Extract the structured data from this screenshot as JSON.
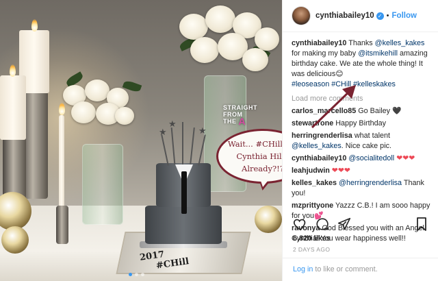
{
  "post": {
    "username": "cynthiabailey10",
    "follow_label": "Follow",
    "separator": "•",
    "caption": {
      "username": "cynthiabailey10",
      "text_1": "Thanks",
      "mention_1": "@kelles_kakes",
      "text_2": "for making my baby",
      "mention_2": "@itsmikehill",
      "text_3": "amazing birthday cake. We ate the whole thing! It was delicious",
      "emoji": "😊",
      "hashtag_1": "#leoseason",
      "hashtag_2": "#CHill",
      "hashtag_3": "#kelleskakes"
    },
    "load_more": "Load more comments",
    "comments": [
      {
        "user": "carlos_marcello85",
        "text": "Go Bailey",
        "emoji": "🖤",
        "emoji_kind": "black-heart"
      },
      {
        "user": "stewartrone",
        "text": "Happy Birthday",
        "emoji": "",
        "emoji_kind": ""
      },
      {
        "user": "herringrenderlisa",
        "text": "what talent",
        "mention": "@kelles_kakes",
        "text_after": ". Nice cake pic.",
        "emoji": "",
        "emoji_kind": ""
      },
      {
        "user": "cynthiabailey10",
        "mention": "@socialitedoll",
        "emoji": "❤❤❤",
        "emoji_kind": "red-hearts"
      },
      {
        "user": "leahjudwin",
        "emoji": "❤❤❤",
        "emoji_kind": "red-hearts"
      },
      {
        "user": "kelles_kakes",
        "mention": "@herringrenderlisa",
        "text_after": "Thank you!"
      },
      {
        "user": "mzprittyone",
        "text": "Yazzz C.B.! I am sooo happy for you",
        "emoji": "💕",
        "emoji_kind": "pink-hearts"
      },
      {
        "user": "ravonya",
        "text": "God Blessed you with an Angel Cynthia! You wear happiness well!!"
      }
    ],
    "likes": "6,820 likes",
    "time_ago": "2 DAYS AGO",
    "login_link": "Log in",
    "login_text": " to like or comment."
  },
  "photo": {
    "bubble_line_1": "Wait... #CHill ???",
    "bubble_line_2": "Cynthia Hill.. Already?!?",
    "cake_text_1": "2017",
    "cake_text_2": "#CHill",
    "watermark_line_1": "STRAIGHT",
    "watermark_line_2": "FROM",
    "watermark_line_3": "THE",
    "watermark_icon": "A"
  },
  "colors": {
    "accent_blue": "#3897f0",
    "bubble_border": "#7a2331",
    "heart_red": "#ed4956"
  },
  "icons": [
    "heart-icon",
    "comment-icon",
    "share-icon",
    "bookmark-icon",
    "verified-icon"
  ]
}
